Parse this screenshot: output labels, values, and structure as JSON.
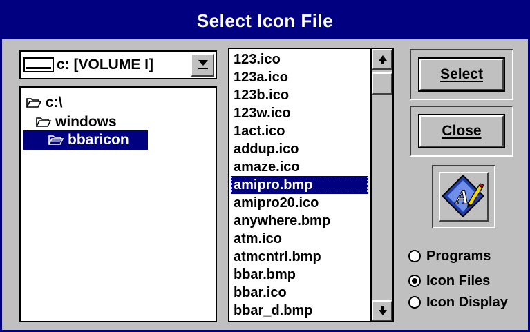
{
  "window": {
    "title": "Select Icon File"
  },
  "drive": {
    "selected": "c: [VOLUME I]"
  },
  "tree": [
    {
      "label": "c:\\",
      "selected": false,
      "open": true
    },
    {
      "label": "windows",
      "selected": false,
      "open": true
    },
    {
      "label": "bbaricon",
      "selected": true,
      "open": true
    }
  ],
  "files": [
    "123.ico",
    "123a.ico",
    "123b.ico",
    "123w.ico",
    "1act.ico",
    "addup.ico",
    "amaze.ico",
    "amipro.bmp",
    "amipro20.ico",
    "anywhere.bmp",
    "atm.ico",
    "atmcntrl.bmp",
    "bbar.bmp",
    "bbar.ico",
    "bbar_d.bmp"
  ],
  "selected_file": "amipro.bmp",
  "buttons": {
    "select": "Select",
    "close": "Close"
  },
  "options": [
    {
      "label": "Programs",
      "checked": false
    },
    {
      "label": "Icon Files",
      "checked": true
    },
    {
      "label": "Icon Display",
      "checked": false
    }
  ],
  "colors": {
    "titlebar": "#000080",
    "face": "#c0c0c0",
    "selection": "#000080"
  }
}
